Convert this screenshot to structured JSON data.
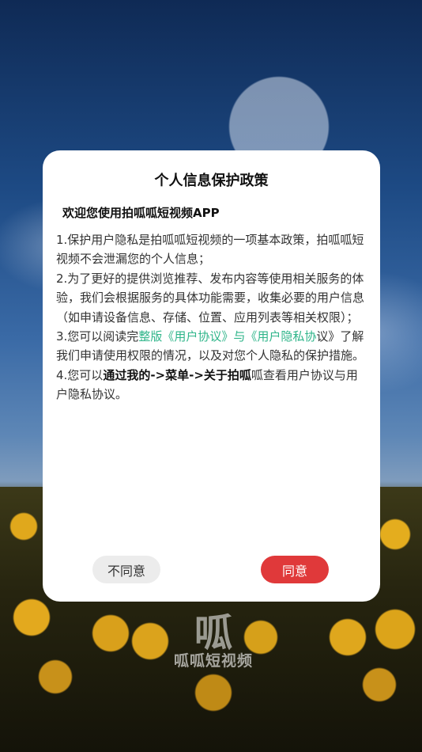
{
  "background": {
    "logo_glyph": "呱",
    "logo_text": "呱呱短视频"
  },
  "dialog": {
    "title": "个人信息保护政策",
    "welcome": "欢迎您使用拍呱呱短视频APP",
    "items": [
      {
        "text": "1.保护用户隐私是拍呱呱短视频的一项基本政策，拍呱呱短视频不会泄漏您的个人信息；"
      },
      {
        "text": "2.为了更好的提供浏览推荐、发布内容等使用相关服务的体验，我们会根据服务的具体功能需要，收集必要的用户信息（如申请设备信息、存储、位置、应用列表等相关权限）；"
      }
    ],
    "item3": {
      "before": "3.您可以阅读完",
      "link_text": "整版《用户协议》与《用户隐私协",
      "after": "议》了解我们申请使用权限的情况，以及对您个人隐私的保护措施。"
    },
    "item4": {
      "before": "4.您可以",
      "strong": "通过我的->菜单->关于拍呱",
      "after": "呱查看用户协议与用户隐私协议。"
    },
    "buttons": {
      "disagree": "不同意",
      "agree": "同意"
    }
  },
  "colors": {
    "agree_button": "#e0393a",
    "link": "#2fb58a"
  }
}
